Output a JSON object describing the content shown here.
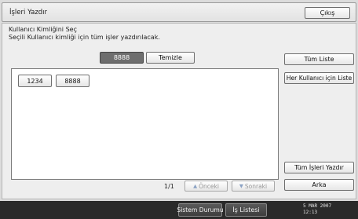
{
  "window": {
    "title": "İşleri Yazdır",
    "exit_label": "Çıkış"
  },
  "instructions": {
    "line1": "Kullanıcı Kimliğini Seç",
    "line2": "Seçili Kullanıcı kimliği için tüm işler yazdırılacak."
  },
  "id_field": {
    "value": "8888",
    "clear_label": "Temizle"
  },
  "user_ids": [
    "1234",
    "8888"
  ],
  "side_buttons": {
    "all_list": "Tüm Liste",
    "per_user_list": "Her Kullanıcı için Liste",
    "print_all": "Tüm İşleri Yazdır",
    "back": "Arka"
  },
  "pagination": {
    "page": "1/1",
    "prev_label": "Önceki",
    "next_label": "Sonraki"
  },
  "status_bar": {
    "system_status": "Sistem Durumu",
    "job_list": "İş Listesi",
    "date": "5 MAR  2007",
    "time": "12:13"
  }
}
